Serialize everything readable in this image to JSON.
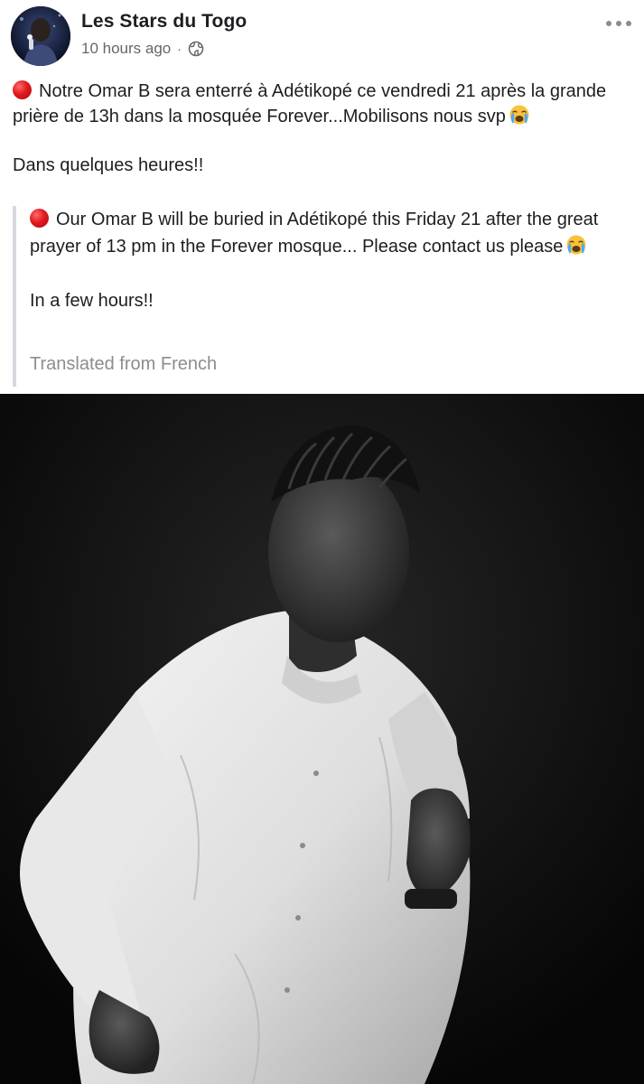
{
  "post": {
    "author": "Les Stars du Togo",
    "time": "10 hours ago",
    "separator": "·",
    "icons": {
      "avatar": "profile-avatar",
      "privacy": "globe-icon",
      "more": "more-options-icon",
      "red_circle": "red-circle-emoji",
      "crying": "loudly-crying-face-emoji"
    },
    "text": {
      "line1": "Notre Omar B sera enterré à Adétikopé ce vendredi 21 après la grande prière de 13h dans la mosquée Forever...Mobilisons nous svp",
      "line2": "Dans quelques heures!!"
    },
    "translation": {
      "line1": "Our Omar B will be buried in Adétikopé this Friday 21 after the great prayer of 13 pm in the Forever mosque... Please contact us please",
      "line2": "In a few hours!!",
      "source_label": "Translated from French"
    },
    "colors": {
      "author": "#1c1e21",
      "meta": "#65676b",
      "translation_border": "#d6d9dd",
      "photo_background": "#0b0b0b"
    }
  }
}
